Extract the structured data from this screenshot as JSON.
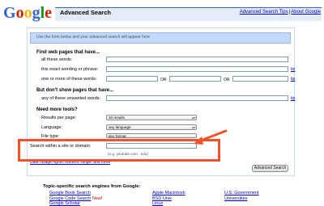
{
  "header": {
    "logo_text": "Google",
    "title": "Advanced Search",
    "links": [
      "Advanced Search Tips",
      "About Google"
    ],
    "separator": "|"
  },
  "preview": {
    "text": "Use the form below and your advanced search will appear here"
  },
  "find_section": {
    "title": "Find web pages that have...",
    "rows": [
      {
        "label": "all these words:",
        "value": ""
      },
      {
        "label": "this exact wording or phrase:",
        "value": "",
        "tip": "tip"
      },
      {
        "label": "one or more of these words:",
        "values": [
          "",
          "",
          ""
        ],
        "or_labels": [
          "OR",
          "OR"
        ],
        "tip": "tip"
      }
    ]
  },
  "exclude_section": {
    "title": "But don't show pages that have...",
    "rows": [
      {
        "label": "any of these unwanted words:",
        "value": "",
        "tip": "tip"
      }
    ]
  },
  "tools_section": {
    "title": "Need more tools?",
    "rows": [
      {
        "label": "Results per page:",
        "selected": "10 results"
      },
      {
        "label": "Language:",
        "selected": "any language"
      },
      {
        "label": "File type:",
        "selected": "any format"
      }
    ]
  },
  "site_search": {
    "label": "Search within a site or domain:",
    "value": "",
    "hint": "(e.g. youtube.com, .edu)"
  },
  "more_link": "Date, usage rights, numeric range, and more",
  "submit_label": "Advanced Search",
  "topic": {
    "title": "Topic-specific search engines from Google:",
    "columns": [
      [
        {
          "label": "Google Book Search"
        },
        {
          "label": "Google Code Search",
          "badge": "New!"
        },
        {
          "label": "Google Scholar"
        }
      ],
      [
        {
          "label": "Apple Macintosh"
        },
        {
          "label": "BSD Unix"
        },
        {
          "label": "Linux"
        }
      ],
      [
        {
          "label": "U.S. Government"
        },
        {
          "label": "Universities"
        }
      ]
    ]
  },
  "colors": {
    "highlight": "#f2532a",
    "link": "#0000cc",
    "header_bar": "#e5ecf9",
    "preview_bar": "#c3d9ff"
  }
}
